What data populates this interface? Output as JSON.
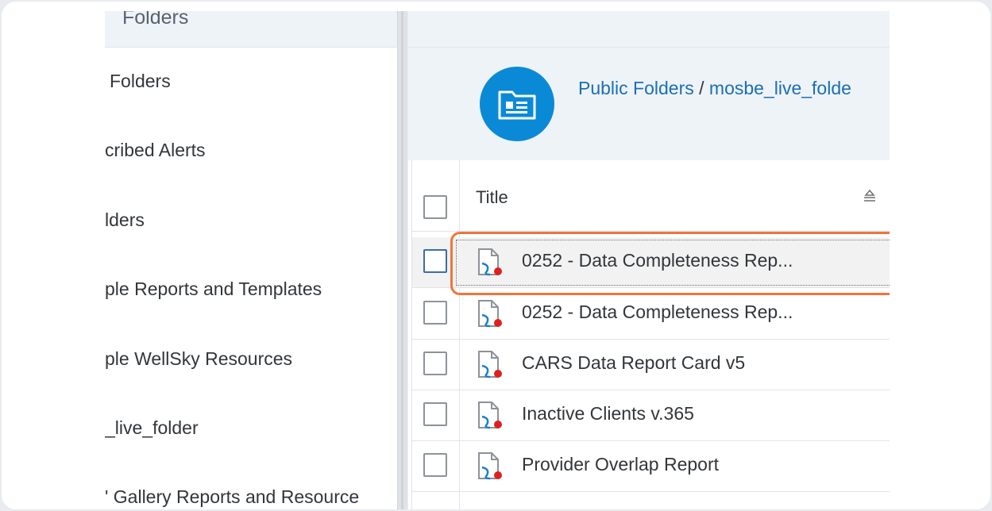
{
  "left_panel": {
    "header": "Folders",
    "items": [
      {
        "label": "Folders"
      },
      {
        "label": "cribed Alerts"
      },
      {
        "label": "lders"
      },
      {
        "label": "ple Reports and Templates"
      },
      {
        "label": "ple WellSky Resources"
      },
      {
        "label": "_live_folder"
      },
      {
        "label": "' Gallery Reports and Resource"
      }
    ]
  },
  "breadcrumb": {
    "root": "Public Folders",
    "separator": "/",
    "current": "mosbe_live_folde"
  },
  "table": {
    "column_title": "Title",
    "rows": [
      {
        "title": "0252 - Data Completeness Rep...",
        "selected": true
      },
      {
        "title": "0252 - Data Completeness Rep...",
        "selected": false
      },
      {
        "title": "CARS Data Report Card v5",
        "selected": false
      },
      {
        "title": "Inactive Clients v.365",
        "selected": false
      },
      {
        "title": "Provider Overlap Report",
        "selected": false
      }
    ]
  },
  "colors": {
    "accent": "#0a8ad6",
    "link": "#1a6fb3",
    "highlight": "#f2743b",
    "doc_icon_badge": "#e02020"
  },
  "icons": {
    "folder_header": "folder-card-icon",
    "row_doc": "webi-document-icon",
    "sort": "sort-icon"
  }
}
